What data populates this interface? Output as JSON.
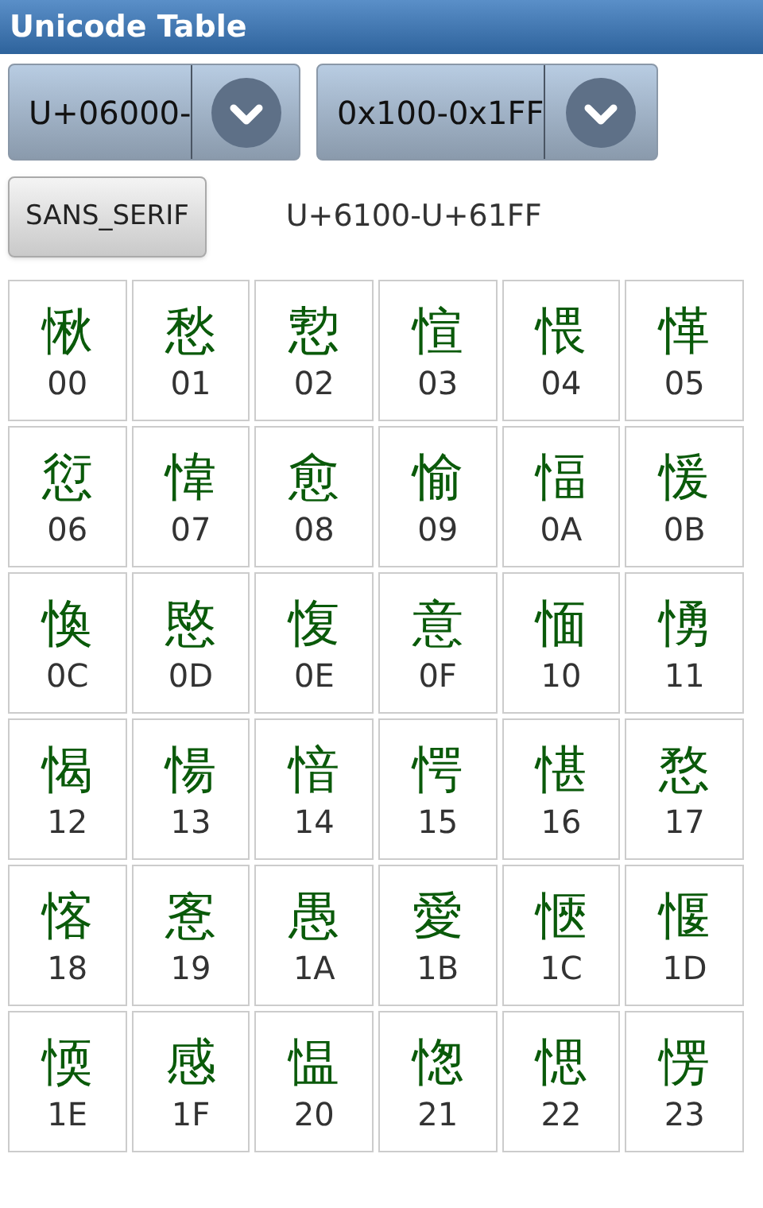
{
  "window": {
    "title": "Unicode Table"
  },
  "spinners": [
    {
      "value": "U+06000-"
    },
    {
      "value": "0x100-0x1FF"
    }
  ],
  "font_button": {
    "label": "SANS_SERIF"
  },
  "range_label": "U+6100-U+61FF",
  "cells": [
    {
      "char": "愀",
      "code": "00"
    },
    {
      "char": "愁",
      "code": "01"
    },
    {
      "char": "愂",
      "code": "02"
    },
    {
      "char": "愃",
      "code": "03"
    },
    {
      "char": "愄",
      "code": "04"
    },
    {
      "char": "愅",
      "code": "05"
    },
    {
      "char": "愆",
      "code": "06"
    },
    {
      "char": "愇",
      "code": "07"
    },
    {
      "char": "愈",
      "code": "08"
    },
    {
      "char": "愉",
      "code": "09"
    },
    {
      "char": "愊",
      "code": "0A"
    },
    {
      "char": "愋",
      "code": "0B"
    },
    {
      "char": "愌",
      "code": "0C"
    },
    {
      "char": "愍",
      "code": "0D"
    },
    {
      "char": "愎",
      "code": "0E"
    },
    {
      "char": "意",
      "code": "0F"
    },
    {
      "char": "愐",
      "code": "10"
    },
    {
      "char": "愑",
      "code": "11"
    },
    {
      "char": "愒",
      "code": "12"
    },
    {
      "char": "愓",
      "code": "13"
    },
    {
      "char": "愔",
      "code": "14"
    },
    {
      "char": "愕",
      "code": "15"
    },
    {
      "char": "愖",
      "code": "16"
    },
    {
      "char": "愗",
      "code": "17"
    },
    {
      "char": "愘",
      "code": "18"
    },
    {
      "char": "愙",
      "code": "19"
    },
    {
      "char": "愚",
      "code": "1A"
    },
    {
      "char": "愛",
      "code": "1B"
    },
    {
      "char": "愜",
      "code": "1C"
    },
    {
      "char": "愝",
      "code": "1D"
    },
    {
      "char": "愞",
      "code": "1E"
    },
    {
      "char": "感",
      "code": "1F"
    },
    {
      "char": "愠",
      "code": "20"
    },
    {
      "char": "愡",
      "code": "21"
    },
    {
      "char": "愢",
      "code": "22"
    },
    {
      "char": "愣",
      "code": "23"
    }
  ]
}
